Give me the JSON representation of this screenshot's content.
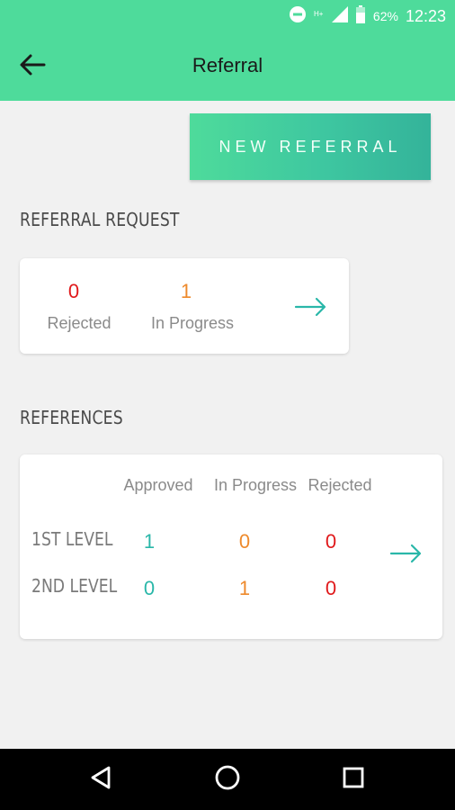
{
  "status": {
    "battery_pct": "62%",
    "time": "12:23"
  },
  "app_bar": {
    "title": "Referral"
  },
  "new_referral_label": "NEW REFERRAL",
  "referral_request": {
    "title": "REFERRAL REQUEST",
    "items": [
      {
        "value": "0",
        "label": "Rejected"
      },
      {
        "value": "1",
        "label": "In Progress"
      }
    ]
  },
  "references": {
    "title": "REFERENCES",
    "headers": [
      "Approved",
      "In Progress",
      "Rejected"
    ],
    "rows": [
      {
        "label": "1ST LEVEL",
        "values": [
          "1",
          "0",
          "0"
        ]
      },
      {
        "label": "2ND LEVEL",
        "values": [
          "0",
          "1",
          "0"
        ]
      }
    ]
  },
  "colors": {
    "primary": "#4edb9b",
    "rejected": "#e0191b",
    "in_progress": "#ee8a2c",
    "approved": "#2ab7a9"
  }
}
